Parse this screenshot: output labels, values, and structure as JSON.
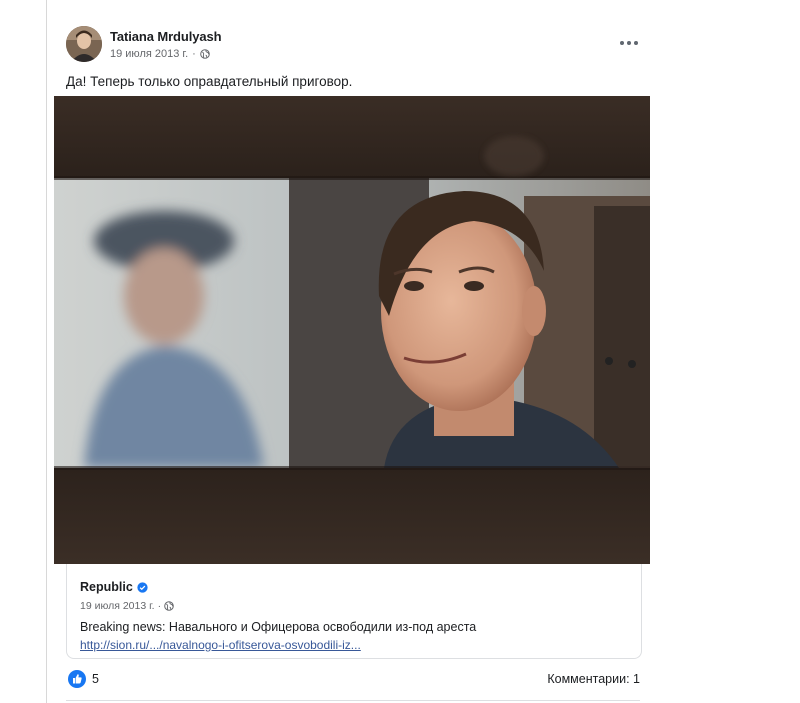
{
  "post": {
    "author": "Tatiana Mrdulyash",
    "date": "19 июля 2013 г.",
    "separator": "·",
    "audience_icon": "globe-icon",
    "menu_icon": "more-horizontal-icon",
    "text": "Да! Теперь только оправдательный приговор."
  },
  "link_preview": {
    "source": "Republic",
    "verified_icon": "verified-badge-icon",
    "date": "19 июля 2013 г.",
    "separator": "·",
    "title": "Breaking news: Навального и Офицерова освободили из-под ареста",
    "url": "http://sion.ru/.../navalnogo-i-ofitserova-osvobodili-iz..."
  },
  "footer": {
    "reaction_icon": "like-icon",
    "reaction_count": "5",
    "comments": "Комментарии: 1"
  },
  "colors": {
    "link": "#385898",
    "accent": "#1877f2",
    "secondary_text": "#65676b"
  }
}
